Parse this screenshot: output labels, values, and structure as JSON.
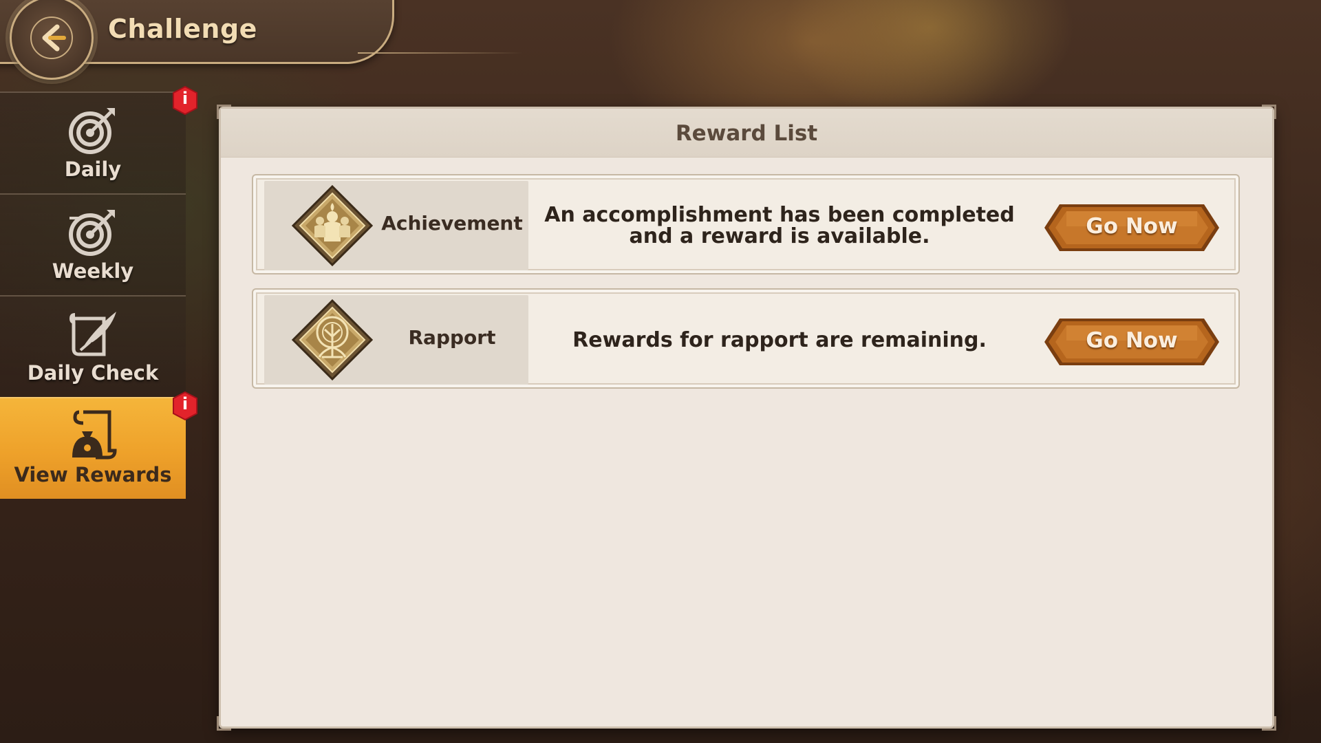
{
  "header": {
    "title": "Challenge",
    "back_icon": "back-arrow-icon"
  },
  "sidebar": {
    "items": [
      {
        "label": "Daily",
        "icon": "target-icon",
        "active": false,
        "badge": "i"
      },
      {
        "label": "Weekly",
        "icon": "target-icon",
        "active": false,
        "badge": null
      },
      {
        "label": "Daily Check",
        "icon": "quill-scroll-icon",
        "active": false,
        "badge": null
      },
      {
        "label": "View Rewards",
        "icon": "reward-scroll-icon",
        "active": true,
        "badge": "i"
      }
    ]
  },
  "panel": {
    "title": "Reward List",
    "rows": [
      {
        "name": "Achievement",
        "icon": "achievement-emblem-icon",
        "description": "An accomplishment has been completed and a reward is available.",
        "button": "Go Now"
      },
      {
        "name": "Rapport",
        "icon": "tree-emblem-icon",
        "description": "Rewards for rapport are remaining.",
        "button": "Go Now"
      }
    ]
  },
  "colors": {
    "accent": "#eea12a",
    "button": "#a85a18",
    "badge": "#e2232b",
    "panel": "#efe7df"
  }
}
